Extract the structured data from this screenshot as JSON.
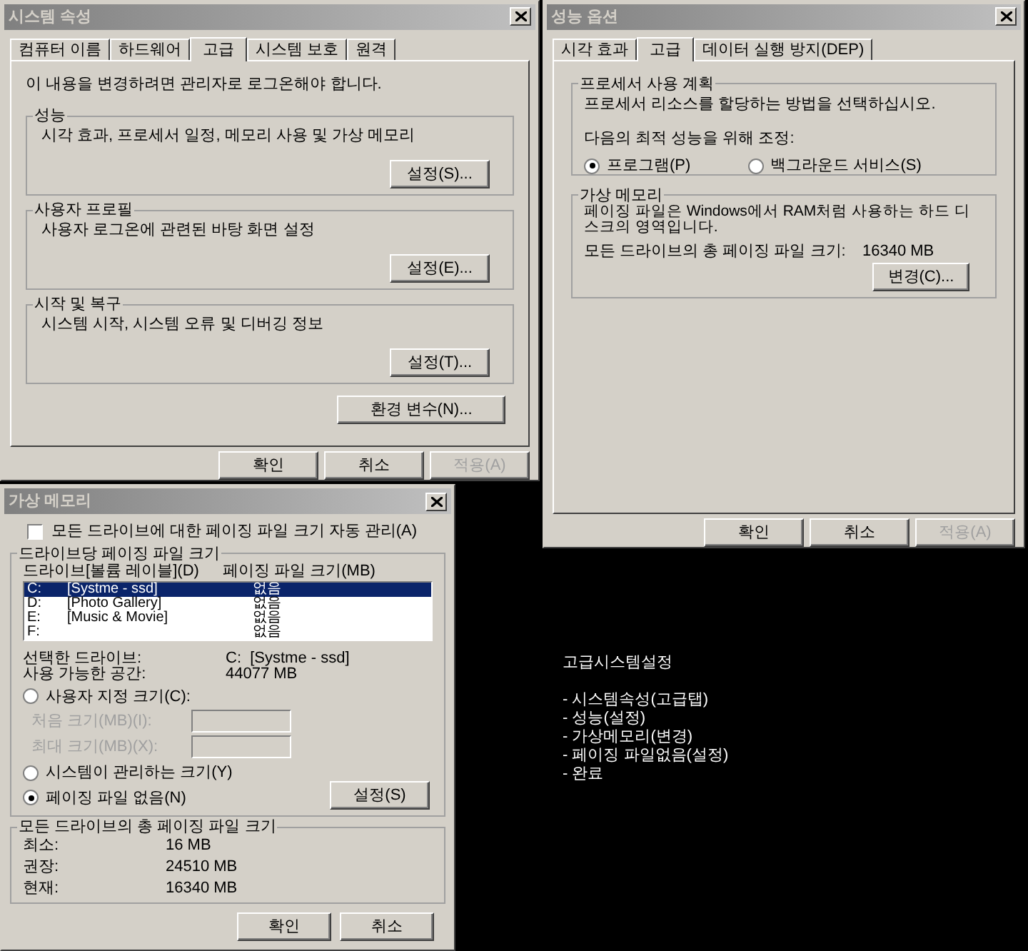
{
  "system_properties": {
    "title": "시스템 속성",
    "tabs": [
      {
        "label": "컴퓨터 이름",
        "selected": false
      },
      {
        "label": "하드웨어",
        "selected": false
      },
      {
        "label": "고급",
        "selected": true
      },
      {
        "label": "시스템 보호",
        "selected": false
      },
      {
        "label": "원격",
        "selected": false
      }
    ],
    "notice": "이 내용을 변경하려면 관리자로 로그온해야 합니다.",
    "groups": [
      {
        "title": "성능",
        "text": "시각 효과, 프로세서 일정, 메모리 사용 및 가상 메모리",
        "button": "설정(S)..."
      },
      {
        "title": "사용자 프로필",
        "text": "사용자 로그온에 관련된 바탕 화면 설정",
        "button": "설정(E)..."
      },
      {
        "title": "시작 및 복구",
        "text": "시스템 시작, 시스템 오류 및 디버깅 정보",
        "button": "설정(T)..."
      }
    ],
    "env_button": "환경 변수(N)...",
    "buttons": [
      {
        "label": "확인",
        "disabled": false
      },
      {
        "label": "취소",
        "disabled": false
      },
      {
        "label": "적용(A)",
        "disabled": true
      }
    ]
  },
  "performance_options": {
    "title": "성능 옵션",
    "tabs": [
      {
        "label": "시각 효과",
        "selected": false
      },
      {
        "label": "고급",
        "selected": true
      },
      {
        "label": "데이터 실행 방지(DEP)",
        "selected": false
      }
    ],
    "scheduling": {
      "title": "프로세서 사용 계획",
      "text": "프로세서 리소스를 할당하는 방법을 선택하십시오.",
      "adjust_label": "다음의 최적 성능을 위해 조정:",
      "options": [
        {
          "label": "프로그램(P)",
          "selected": true
        },
        {
          "label": "백그라운드 서비스(S)",
          "selected": false
        }
      ]
    },
    "virtual_memory": {
      "title": "가상 메모리",
      "text": "페이징 파일은 Windows에서 RAM처럼 사용하는 하드 디스크의 영역입니다.",
      "total_label": "모든 드라이브의 총 페이징 파일 크기:",
      "total_value": "16340 MB",
      "button": "변경(C)..."
    },
    "buttons": [
      {
        "label": "확인",
        "disabled": false
      },
      {
        "label": "취소",
        "disabled": false
      },
      {
        "label": "적용(A)",
        "disabled": true
      }
    ]
  },
  "virtual_memory": {
    "title": "가상 메모리",
    "auto_manage": {
      "label": "모든 드라이브에 대한 페이징 파일 크기 자동 관리(A)",
      "checked": false
    },
    "per_drive": {
      "title": "드라이브당 페이징 파일 크기",
      "columns": [
        "드라이브[볼륨 레이블](D)",
        "페이징 파일 크기(MB)"
      ],
      "drives": [
        {
          "drive": "C:",
          "label": "[Systme - ssd]",
          "size": "없음",
          "selected": true
        },
        {
          "drive": "D:",
          "label": "[Photo Gallery]",
          "size": "없음",
          "selected": false
        },
        {
          "drive": "E:",
          "label": "[Music & Movie]",
          "size": "없음",
          "selected": false
        },
        {
          "drive": "F:",
          "size": "없음",
          "selected": false
        }
      ],
      "info": [
        {
          "label": "선택한 드라이브:",
          "value": "C:  [Systme - ssd]"
        },
        {
          "label": "사용 가능한 공간:",
          "value": "44077 MB"
        }
      ],
      "size_options": [
        {
          "label": "사용자 지정 크기(C):",
          "selected": false
        },
        {
          "label": "시스템이 관리하는 크기(Y)",
          "selected": false
        },
        {
          "label": "페이징 파일 없음(N)",
          "selected": true
        }
      ],
      "size_fields": [
        {
          "label": "처음 크기(MB)(I):",
          "disabled": true
        },
        {
          "label": "최대 크기(MB)(X):",
          "disabled": true
        }
      ],
      "set_button": "설정(S)"
    },
    "totals": {
      "title": "모든 드라이브의 총 페이징 파일 크기",
      "rows": [
        {
          "label": "최소:",
          "value": "16 MB"
        },
        {
          "label": "권장:",
          "value": "24510 MB"
        },
        {
          "label": "현재:",
          "value": "16340 MB"
        }
      ]
    },
    "buttons": [
      {
        "label": "확인",
        "disabled": false
      },
      {
        "label": "취소",
        "disabled": false
      }
    ]
  },
  "note": {
    "title": "고급시스템설정",
    "items": [
      "- 시스템속성(고급탭)",
      "- 성능(설정)",
      "- 가상메모리(변경)",
      "- 페이징 파일없음(설정)",
      "- 완료"
    ]
  }
}
